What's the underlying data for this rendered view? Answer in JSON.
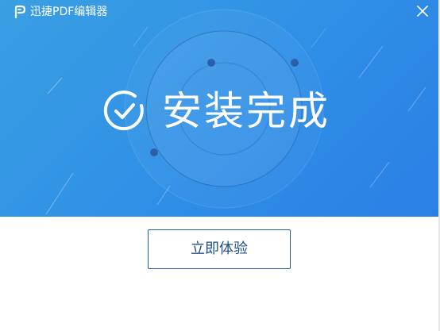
{
  "window": {
    "title": "迅捷PDF编辑器",
    "close_icon": "close-icon",
    "logo_icon": "app-logo-icon"
  },
  "banner": {
    "headline": "安装完成",
    "status_icon": "check-circle-icon",
    "colors": {
      "gradient_start": "#3a9fe3",
      "gradient_end": "#2a7fe3",
      "dot": "#2b5fa8"
    }
  },
  "actions": {
    "primary_label": "立即体验",
    "border_color": "#1f5f9e",
    "text_color": "#1e4f85"
  }
}
